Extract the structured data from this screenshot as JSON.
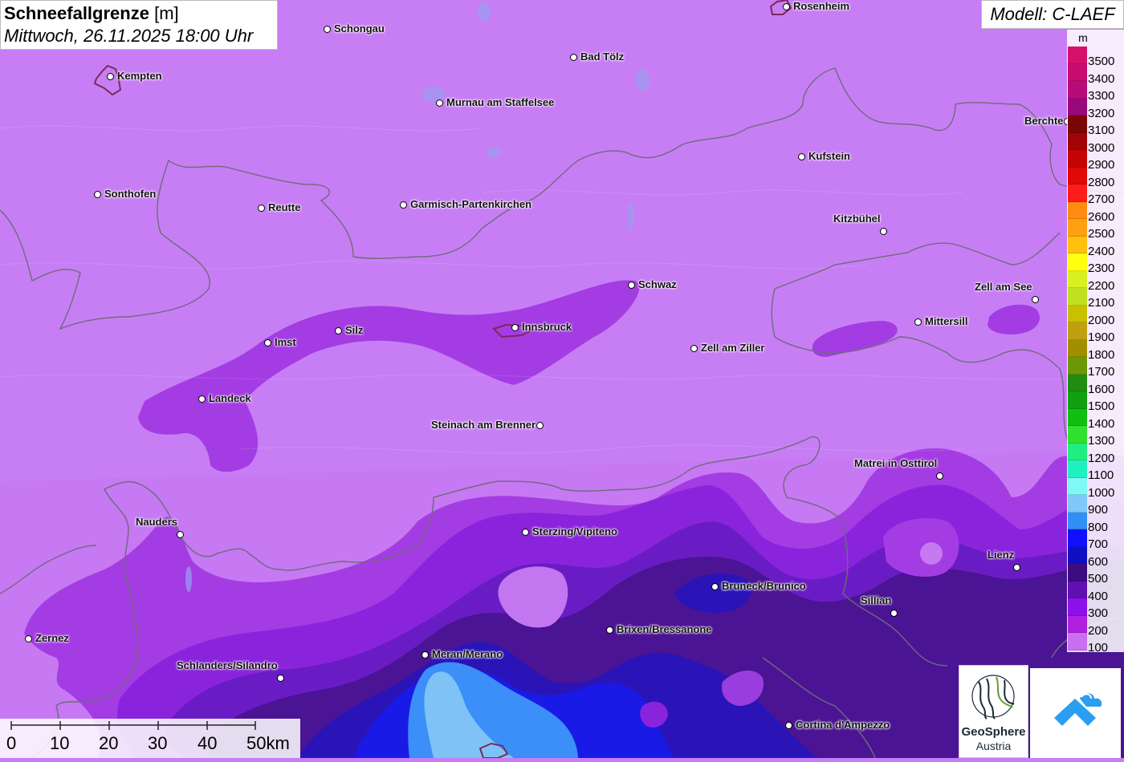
{
  "header": {
    "title_bold": "Schneefallgrenze",
    "title_unit": "[m]",
    "datetime": "Mittwoch, 26.11.2025 18:00 Uhr",
    "model": "Modell: C-LAEF"
  },
  "legend": {
    "unit": "m",
    "items": [
      {
        "label": "3500",
        "color": "#d4106a"
      },
      {
        "label": "3400",
        "color": "#c80c70"
      },
      {
        "label": "3300",
        "color": "#b80a78"
      },
      {
        "label": "3200",
        "color": "#98087a"
      },
      {
        "label": "3100",
        "color": "#7a0606"
      },
      {
        "label": "3000",
        "color": "#a00404"
      },
      {
        "label": "2900",
        "color": "#c40404"
      },
      {
        "label": "2800",
        "color": "#e00808"
      },
      {
        "label": "2700",
        "color": "#ff1c1c"
      },
      {
        "label": "2600",
        "color": "#ff8c10"
      },
      {
        "label": "2500",
        "color": "#ffa010"
      },
      {
        "label": "2400",
        "color": "#ffc010"
      },
      {
        "label": "2300",
        "color": "#ffff10"
      },
      {
        "label": "2200",
        "color": "#d8f020"
      },
      {
        "label": "2100",
        "color": "#c0e020"
      },
      {
        "label": "2000",
        "color": "#c8c000"
      },
      {
        "label": "1900",
        "color": "#c0a010"
      },
      {
        "label": "1800",
        "color": "#a09000"
      },
      {
        "label": "1700",
        "color": "#6c9808"
      },
      {
        "label": "1600",
        "color": "#208c10"
      },
      {
        "label": "1500",
        "color": "#10a010"
      },
      {
        "label": "1400",
        "color": "#10c010"
      },
      {
        "label": "1300",
        "color": "#30e030"
      },
      {
        "label": "1200",
        "color": "#20ee80"
      },
      {
        "label": "1100",
        "color": "#20f0c0"
      },
      {
        "label": "1000",
        "color": "#80f8f8"
      },
      {
        "label": "900",
        "color": "#80c8f8"
      },
      {
        "label": "800",
        "color": "#3090f8"
      },
      {
        "label": "700",
        "color": "#1010ff"
      },
      {
        "label": "600",
        "color": "#1010c0"
      },
      {
        "label": "500",
        "color": "#3c0c80"
      },
      {
        "label": "400",
        "color": "#6010b0"
      },
      {
        "label": "300",
        "color": "#8c10e8"
      },
      {
        "label": "200",
        "color": "#b020e0"
      },
      {
        "label": "100",
        "color": "#c870f0"
      }
    ]
  },
  "cities": [
    {
      "name": "Rosenheim"
    },
    {
      "name": "Schongau"
    },
    {
      "name": "Kempten"
    },
    {
      "name": "Bad Tölz"
    },
    {
      "name": "Murnau am Staffelsee"
    },
    {
      "name": "Berchte"
    },
    {
      "name": "Kufstein"
    },
    {
      "name": "Sonthofen"
    },
    {
      "name": "Reutte"
    },
    {
      "name": "Garmisch-Partenkirchen"
    },
    {
      "name": "Kitzbühel"
    },
    {
      "name": "Schwaz"
    },
    {
      "name": "Zell am See"
    },
    {
      "name": "Mittersill"
    },
    {
      "name": "Imst"
    },
    {
      "name": "Silz"
    },
    {
      "name": "Innsbruck"
    },
    {
      "name": "Zell am Ziller"
    },
    {
      "name": "Landeck"
    },
    {
      "name": "Steinach am Brenner"
    },
    {
      "name": "Matrei in Osttirol"
    },
    {
      "name": "Nauders"
    },
    {
      "name": "Sterzing/Vipiteno"
    },
    {
      "name": "Lienz"
    },
    {
      "name": "Bruneck/Brunico"
    },
    {
      "name": "Sillian"
    },
    {
      "name": "Brixen/Bressanone"
    },
    {
      "name": "Zernez"
    },
    {
      "name": "Meran/Merano"
    },
    {
      "name": "Schlanders/Silandro"
    },
    {
      "name": "Cortina d'Ampezzo"
    }
  ],
  "scalebar": {
    "labels": [
      "0",
      "10",
      "20",
      "30",
      "40",
      "50km"
    ]
  },
  "logos": {
    "geosphere_name": "GeoSphere",
    "geosphere_sub": "Austria"
  }
}
